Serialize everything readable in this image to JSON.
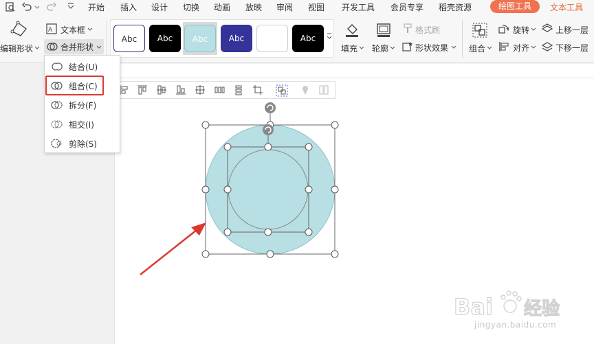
{
  "menu": {
    "items": [
      "开始",
      "插入",
      "设计",
      "切换",
      "动画",
      "放映",
      "审阅",
      "视图",
      "开发工具",
      "会员专享",
      "稻壳资源"
    ],
    "drawing_tools": "绘图工具",
    "text_tools": "文本工具"
  },
  "ribbon": {
    "edit_shape": "编辑形状",
    "text_box": "文本框",
    "merge_shapes": "合并形状",
    "styles": [
      "Abc",
      "Abc",
      "Abc",
      "Abc",
      "",
      "Abc"
    ],
    "fill": "填充",
    "outline": "轮廓",
    "format_painter": "格式刷",
    "shape_effects": "形状效果",
    "group": "组合",
    "rotate": "旋转",
    "align": "对齐",
    "bring_forward": "上移一层",
    "send_backward": "下移一层"
  },
  "dropdown": {
    "items": [
      "结合(U)",
      "组合(C)",
      "拆分(F)",
      "相交(I)",
      "剪除(S)"
    ]
  },
  "watermark": {
    "brand": "Bai",
    "brand2": "经验",
    "url": "jingyan.baidu.com"
  },
  "colors": {
    "accent_pill": "#f0724f",
    "text_tools": "#e8673a",
    "shape_fill": "#b8dfe3",
    "highlight": "#d93a2f",
    "arrow": "#d93a2f"
  }
}
